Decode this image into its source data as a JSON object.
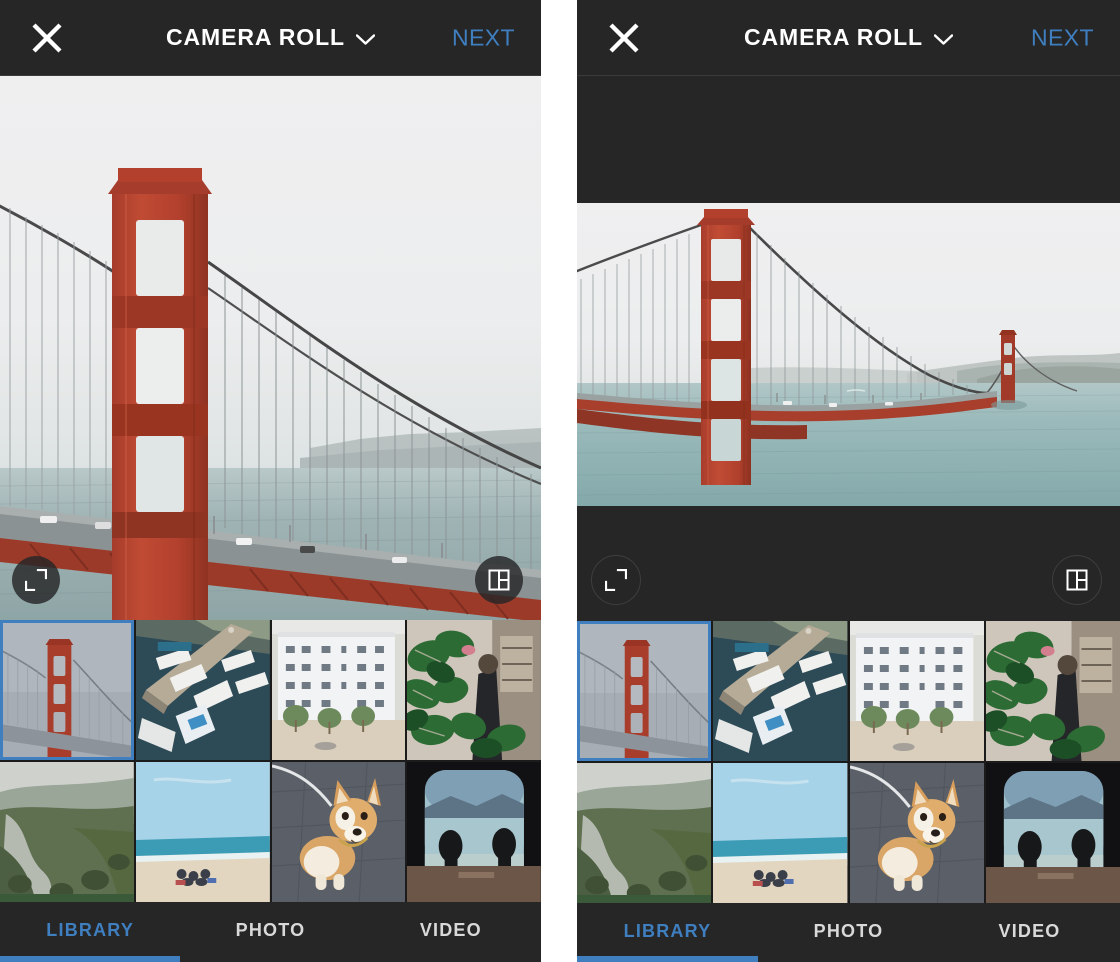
{
  "app": {
    "accent_blue": "#3f7fbf",
    "chrome_dark": "#262627",
    "grid_bg": "#1b1b1c"
  },
  "header": {
    "close_icon": "close-icon",
    "title": "CAMERA ROLL",
    "chevron_icon": "chevron-down-icon",
    "next_label": "NEXT"
  },
  "preview": {
    "expand_icon": "expand-icon",
    "layout_icon": "layout-grid-icon",
    "left_mode": "cropped-square",
    "right_mode": "letterboxed-full"
  },
  "thumbnails": [
    {
      "name": "golden-gate-bridge-fog",
      "selected": true
    },
    {
      "name": "marina-boats-dock",
      "selected": false
    },
    {
      "name": "white-apartment-building",
      "selected": false
    },
    {
      "name": "monstera-plant-interior",
      "selected": false
    },
    {
      "name": "coastal-road-hillside",
      "selected": false
    },
    {
      "name": "beach-crowd-ocean",
      "selected": false
    },
    {
      "name": "corgi-dog-sidewalk",
      "selected": false
    },
    {
      "name": "airplane-window-silhouettes",
      "selected": false
    }
  ],
  "tabs": [
    {
      "label": "LIBRARY",
      "active": true
    },
    {
      "label": "PHOTO",
      "active": false
    },
    {
      "label": "VIDEO",
      "active": false
    }
  ]
}
